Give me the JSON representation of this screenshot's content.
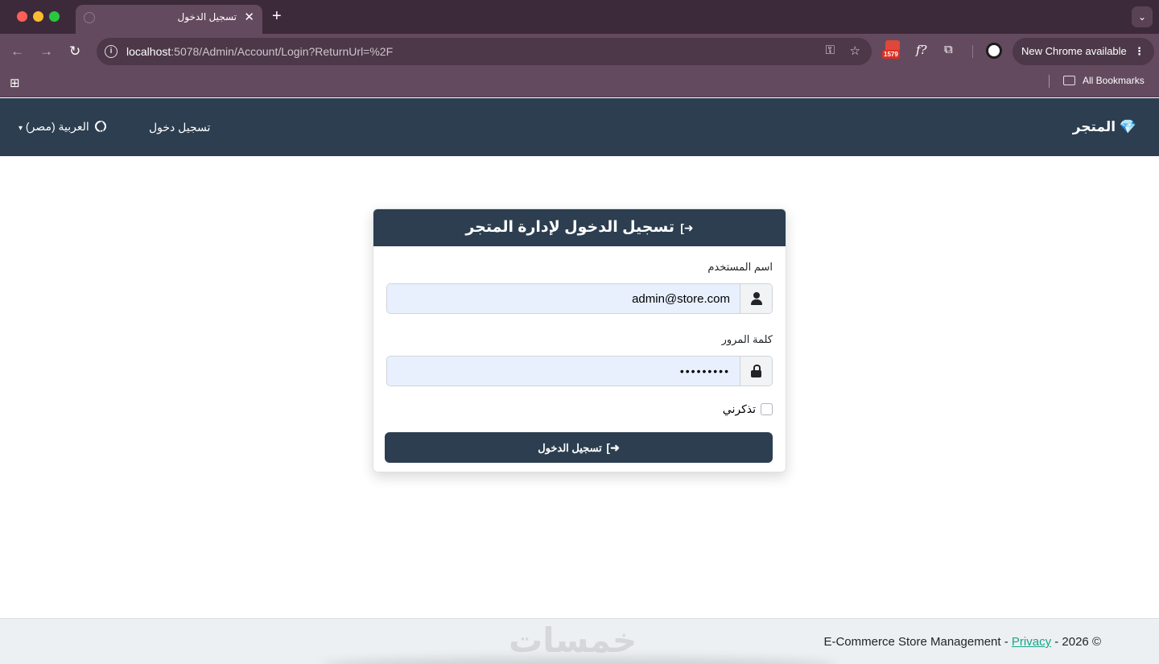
{
  "browser": {
    "tab_title": "تسجيل الدخول",
    "tab_close": "✕",
    "new_tab": "+",
    "tab_search": "⌄",
    "nav": {
      "back": "←",
      "forward": "→",
      "reload": "↻"
    },
    "url_host": "localhost",
    "url_path": ":5078/Admin/Account/Login?ReturnUrl=%2F",
    "extension_badge": "1579",
    "extension_fx": "f?",
    "update_pill": "New Chrome available",
    "update_menu": "⋮",
    "bookmarks_folder": "All Bookmarks",
    "icons": [
      "site-info-icon",
      "key-icon",
      "star-icon",
      "puzzle-icon",
      "apps-grid-icon",
      "folder-icon"
    ]
  },
  "navbar": {
    "brand_icon": "💎",
    "brand": "المتجر",
    "login_link": "تسجيل دخول",
    "language": "العربية (مصر)",
    "language_caret": "▾"
  },
  "login": {
    "title": "تسجيل الدخول لإدارة المتجر",
    "title_icon": "➜]",
    "username_label": "اسم المستخدم",
    "username_value": "admin@store.com",
    "password_label": "كلمة المرور",
    "password_value": "•••••••••",
    "remember_label": "تذكرني",
    "submit_label": "تسجيل الدخول",
    "submit_icon": "➜]"
  },
  "footer": {
    "prefix": "E-Commerce Store Management - ",
    "privacy_link": "Privacy",
    "suffix": " - 2026 ©",
    "watermark": "خمسات"
  },
  "colors": {
    "navbar": "#2c3e50",
    "link": "#17a589",
    "input_fill": "#e8f0fe",
    "tab_active": "#644a5f"
  }
}
